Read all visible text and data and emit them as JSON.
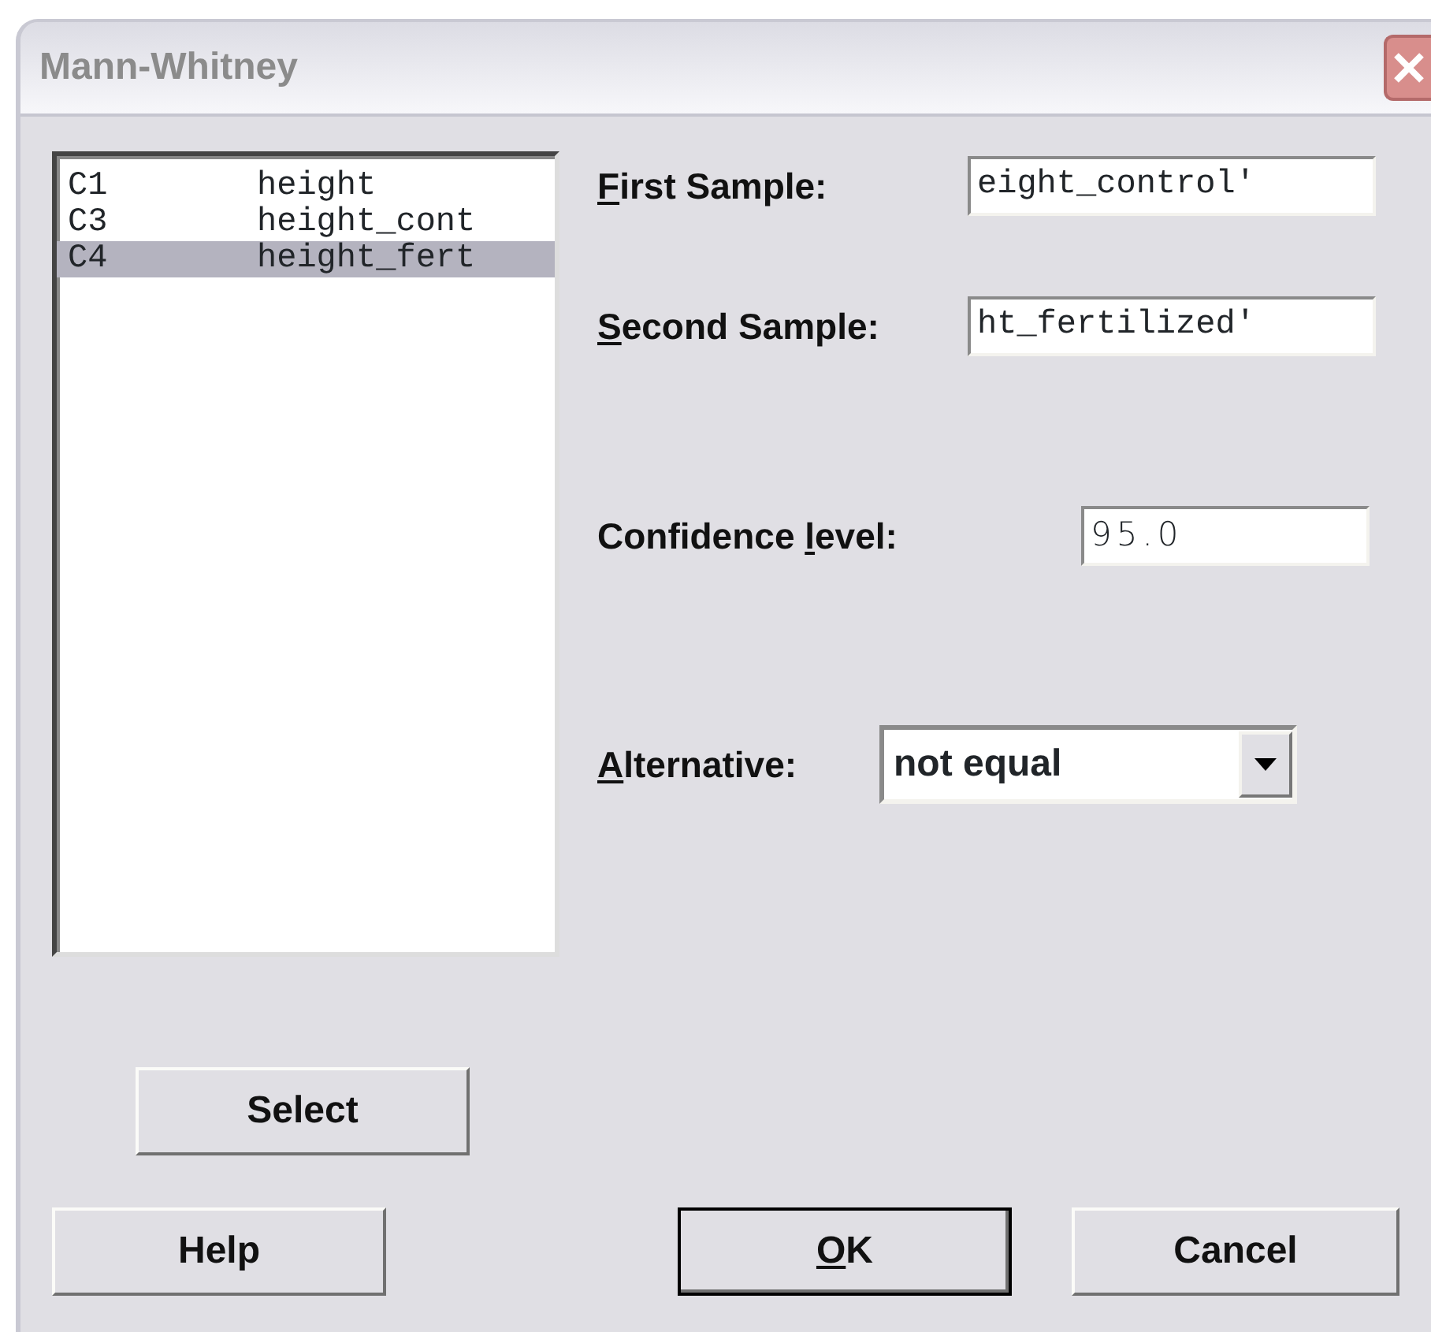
{
  "window": {
    "title": "Mann-Whitney"
  },
  "variables": [
    {
      "column": "C1",
      "name": "height",
      "selected": false
    },
    {
      "column": "C3",
      "name": "height_cont",
      "selected": false
    },
    {
      "column": "C4",
      "name": "height_fert",
      "selected": true
    }
  ],
  "fields": [
    {
      "kind": "text",
      "access_key": "F",
      "label_rest": "irst Sample:",
      "value": "eight_control'"
    },
    {
      "kind": "text",
      "access_key": "S",
      "label_rest": "econd Sample:",
      "value": "ht_fertilized'"
    },
    {
      "kind": "number",
      "label_start": "Confidence ",
      "access_key": "l",
      "label_rest": "evel:",
      "value": "95.0"
    },
    {
      "kind": "dropdown",
      "access_key": "A",
      "label_rest": "lternative:",
      "value": "not equal"
    }
  ],
  "select_button": {
    "label_rest": "Select"
  },
  "buttons": [
    {
      "label_rest": "Help",
      "default": false
    },
    {
      "access_key": "O",
      "label_rest": "K",
      "default": true
    },
    {
      "label_rest": "Cancel",
      "default": false
    }
  ]
}
